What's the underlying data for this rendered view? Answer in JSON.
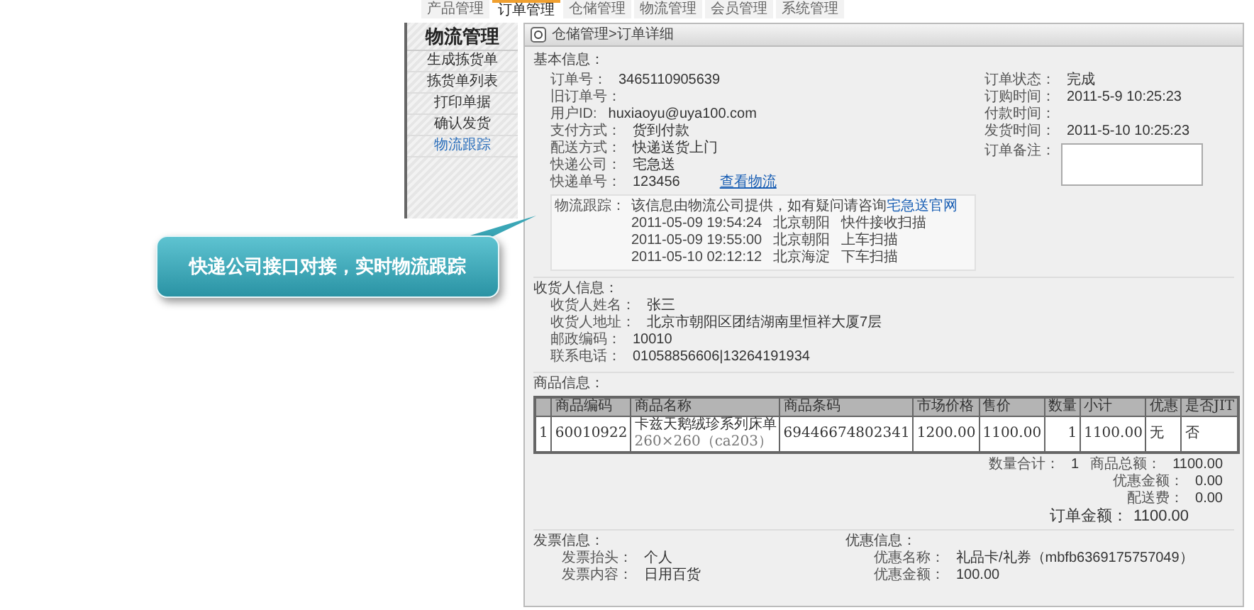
{
  "top_nav": [
    {
      "label": "产品管理",
      "selected": false
    },
    {
      "label": "订单管理",
      "selected": true
    },
    {
      "label": "仓储管理",
      "selected": false
    },
    {
      "label": "物流管理",
      "selected": false
    },
    {
      "label": "会员管理",
      "selected": false
    },
    {
      "label": "系统管理",
      "selected": false
    }
  ],
  "sidebar": {
    "title": "物流管理",
    "items": [
      {
        "label": "生成拣货单",
        "selected": false
      },
      {
        "label": "拣货单列表",
        "selected": false
      },
      {
        "label": "打印单据",
        "selected": false
      },
      {
        "label": "确认发货",
        "selected": false
      },
      {
        "label": "物流跟踪",
        "selected": true
      }
    ]
  },
  "breadcrumb": "仓储管理>订单详细",
  "basic_info": {
    "heading": "基本信息：",
    "left": [
      {
        "label": "订单号：",
        "value": "3465110905639"
      },
      {
        "label": "旧订单号："
      },
      {
        "label": "用户ID:",
        "value": "huxiaoyu@uya100.com"
      },
      {
        "label": "支付方式：",
        "value": "货到付款"
      },
      {
        "label": "配送方式：",
        "value": "快递送货上门"
      },
      {
        "label": "快递公司：",
        "value": "宅急送"
      },
      {
        "label": "快递单号：",
        "value": "123456",
        "link": "查看物流"
      }
    ],
    "right": [
      {
        "label": "订单状态：",
        "value": "完成"
      },
      {
        "label": "订购时间：",
        "value": "2011-5-9 10:25:23"
      },
      {
        "label": "付款时间："
      },
      {
        "label": "发货时间：",
        "value": "2011-5-10 10:25:23"
      }
    ],
    "remark_label": "订单备注："
  },
  "tracking": {
    "label": "物流跟踪：",
    "intro": "该信息由物流公司提供，如有疑问请咨询",
    "link": "宅急送官网",
    "events": [
      {
        "time": "2011-05-09 19:54:24",
        "place": "北京朝阳",
        "status": "快件接收扫描"
      },
      {
        "time": "2011-05-09 19:55:00",
        "place": "北京朝阳",
        "status": "上车扫描"
      },
      {
        "time": "2011-05-10 02:12:12",
        "place": "北京海淀",
        "status": "下车扫描"
      }
    ]
  },
  "receiver": {
    "heading": "收货人信息：",
    "rows": [
      {
        "label": "收货人姓名：",
        "value": "张三"
      },
      {
        "label": "收货人地址：",
        "value": "北京市朝阳区团结湖南里恒祥大厦7层"
      },
      {
        "label": "邮政编码：",
        "value": "10010"
      },
      {
        "label": "联系电话：",
        "value": "01058856606|13264191934"
      }
    ]
  },
  "goods": {
    "heading": "商品信息：",
    "columns": [
      "",
      "商品编码",
      "商品名称",
      "商品条码",
      "市场价格",
      "售价",
      "数量",
      "小计",
      "优惠",
      "是否JIT"
    ],
    "rows": [
      {
        "cells": [
          "1",
          "60010922",
          "卡兹天鹅绒珍系列床单",
          "69446674802341",
          "1200.00",
          "1100.00",
          "1",
          "1100.00",
          "无",
          "否"
        ],
        "spec": "260×260（ca203）"
      }
    ],
    "totals": [
      {
        "label": "数量合计：",
        "value": "1"
      },
      {
        "label": "商品总额：",
        "value": "1100.00"
      },
      {
        "label": "优惠金额：",
        "value": "0.00"
      },
      {
        "label": "配送费：",
        "value": "0.00"
      }
    ],
    "grand_total": {
      "label": "订单金额：",
      "value": "1100.00"
    }
  },
  "invoice": {
    "heading": "发票信息：",
    "rows": [
      {
        "label": "发票抬头：",
        "value": "个人"
      },
      {
        "label": "发票内容：",
        "value": "日用百货"
      }
    ]
  },
  "discount": {
    "heading": "优惠信息：",
    "rows": [
      {
        "label": "优惠名称：",
        "value": "礼品卡/礼券（mbfb6369175757049）"
      },
      {
        "label": "优惠金额：",
        "value": "100.00"
      }
    ]
  },
  "callout": "快递公司接口对接，实时物流跟踪"
}
